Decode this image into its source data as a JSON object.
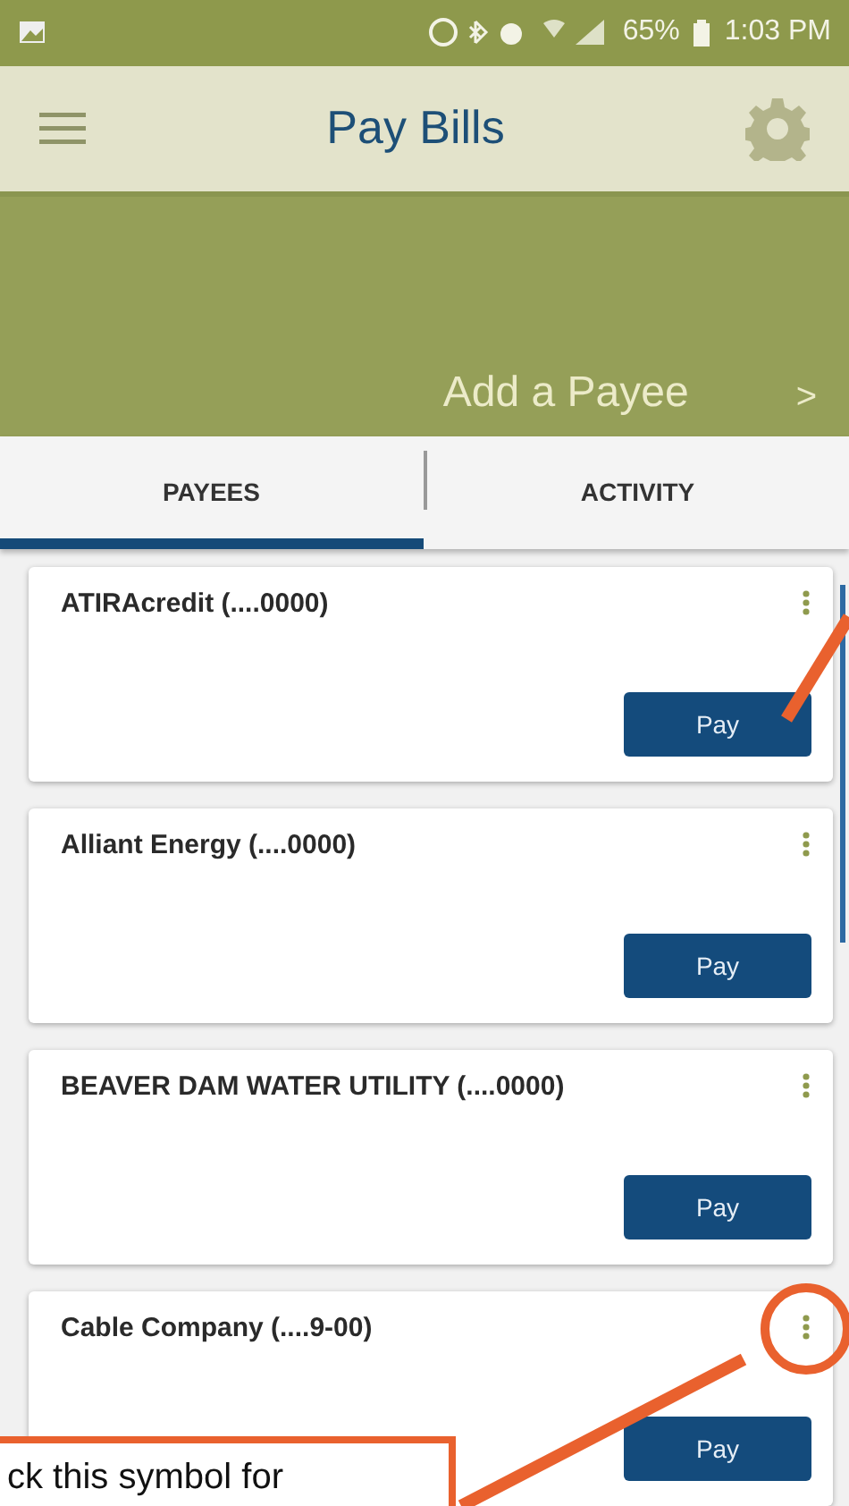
{
  "status_bar": {
    "battery": "65%",
    "time": "1:03 PM"
  },
  "header": {
    "title": "Pay Bills"
  },
  "banner": {
    "action": "Add a Payee",
    "chevron": ">"
  },
  "tabs": [
    {
      "label": "PAYEES",
      "selected": true
    },
    {
      "label": "ACTIVITY",
      "selected": false
    }
  ],
  "payees": [
    {
      "name": "ATIRAcredit (....0000)",
      "button": "Pay"
    },
    {
      "name": "Alliant Energy (....0000)",
      "button": "Pay"
    },
    {
      "name": "BEAVER DAM WATER UTILITY (....0000)",
      "button": "Pay"
    },
    {
      "name": "Cable Company (....9-00)",
      "button": "Pay"
    }
  ],
  "callout": {
    "text": "ck this symbol for"
  }
}
